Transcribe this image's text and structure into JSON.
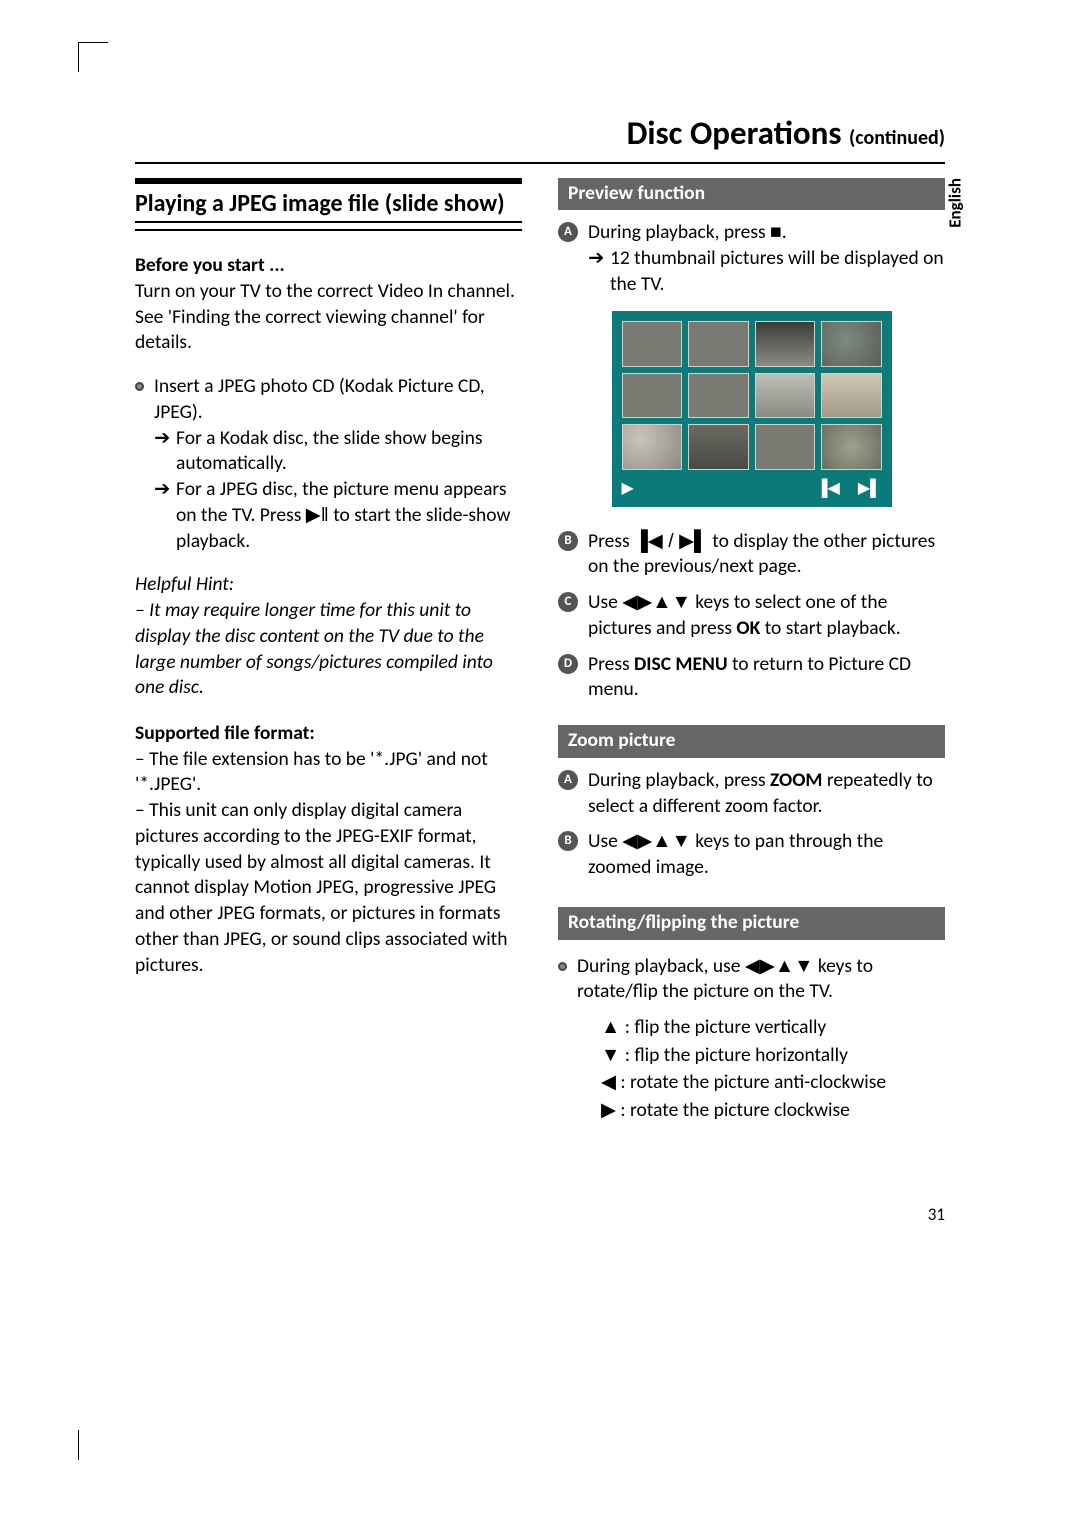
{
  "header": {
    "title": "Disc Operations",
    "continued": "(continued)"
  },
  "lang_tab": "English",
  "page_number": "31",
  "left": {
    "section_title": "Playing a JPEG image file (slide show)",
    "before_head": "Before you start ...",
    "before_text": "Turn on your TV to the correct Video In channel. See 'Finding the correct viewing channel' for details.",
    "insert_text": "Insert a JPEG photo CD (Kodak Picture CD, JPEG).",
    "kodak_arrow": "For a Kodak disc, the slide show begins automatically.",
    "jpeg_arrow_1": "For a JPEG disc, the picture menu appears on the TV. Press ",
    "jpeg_arrow_2": " to start the slide-show playback.",
    "hint_label": "Helpful Hint:",
    "hint_text": "– It may require longer time for this unit to display the disc content on the TV due to the large number of songs/pictures compiled into one disc.",
    "supported_head": "Supported file format:",
    "supported_1": "– The file extension has to be '*.JPG' and not '*.JPEG'.",
    "supported_2": "– This unit can only display digital camera pictures according to the JPEG-EXIF format, typically used by almost all digital cameras. It cannot display Motion JPEG, progressive JPEG and other JPEG formats, or pictures in formats other than JPEG, or sound clips associated with pictures."
  },
  "right": {
    "preview_head": "Preview function",
    "step1_a": "During playback, press ",
    "step1_b": ".",
    "step1_arrow": "12 thumbnail pictures will be displayed on the TV.",
    "step2_a": "Press  ",
    "step2_b": "  to display the other pictures on the previous/next page.",
    "step3_a": "Use ",
    "step3_b": " keys to select one of the pictures and press ",
    "step3_ok": "OK",
    "step3_c": " to start playback.",
    "step4_a": "Press ",
    "step4_disc": "DISC MENU",
    "step4_b": " to return to Picture CD menu.",
    "zoom_head": "Zoom picture",
    "zoom1_a": "During playback, press ",
    "zoom1_zoom": "ZOOM",
    "zoom1_b": " repeatedly to select a different zoom factor.",
    "zoom2_a": "Use ",
    "zoom2_b": " keys to pan through the zoomed image.",
    "rotate_head": "Rotating/flipping the picture",
    "rotate_intro_a": "During playback, use ",
    "rotate_intro_b": " keys to rotate/flip the picture on the TV.",
    "action_up": " : flip the picture vertically",
    "action_down": " : flip the picture horizontally",
    "action_left": " : rotate the picture anti-clockwise",
    "action_right": " : rotate the picture clockwise"
  },
  "steps": {
    "a": "A",
    "b": "B",
    "c": "C",
    "d": "D"
  },
  "glyphs": {
    "arrow_right": "➔",
    "play_pause": "▶ǁ",
    "stop": "■",
    "prev": "▐◀",
    "next": "▶▌",
    "left": "◀",
    "right": "▶",
    "up": "▲",
    "down": "▼",
    "play": "▶",
    "slash": " / "
  }
}
